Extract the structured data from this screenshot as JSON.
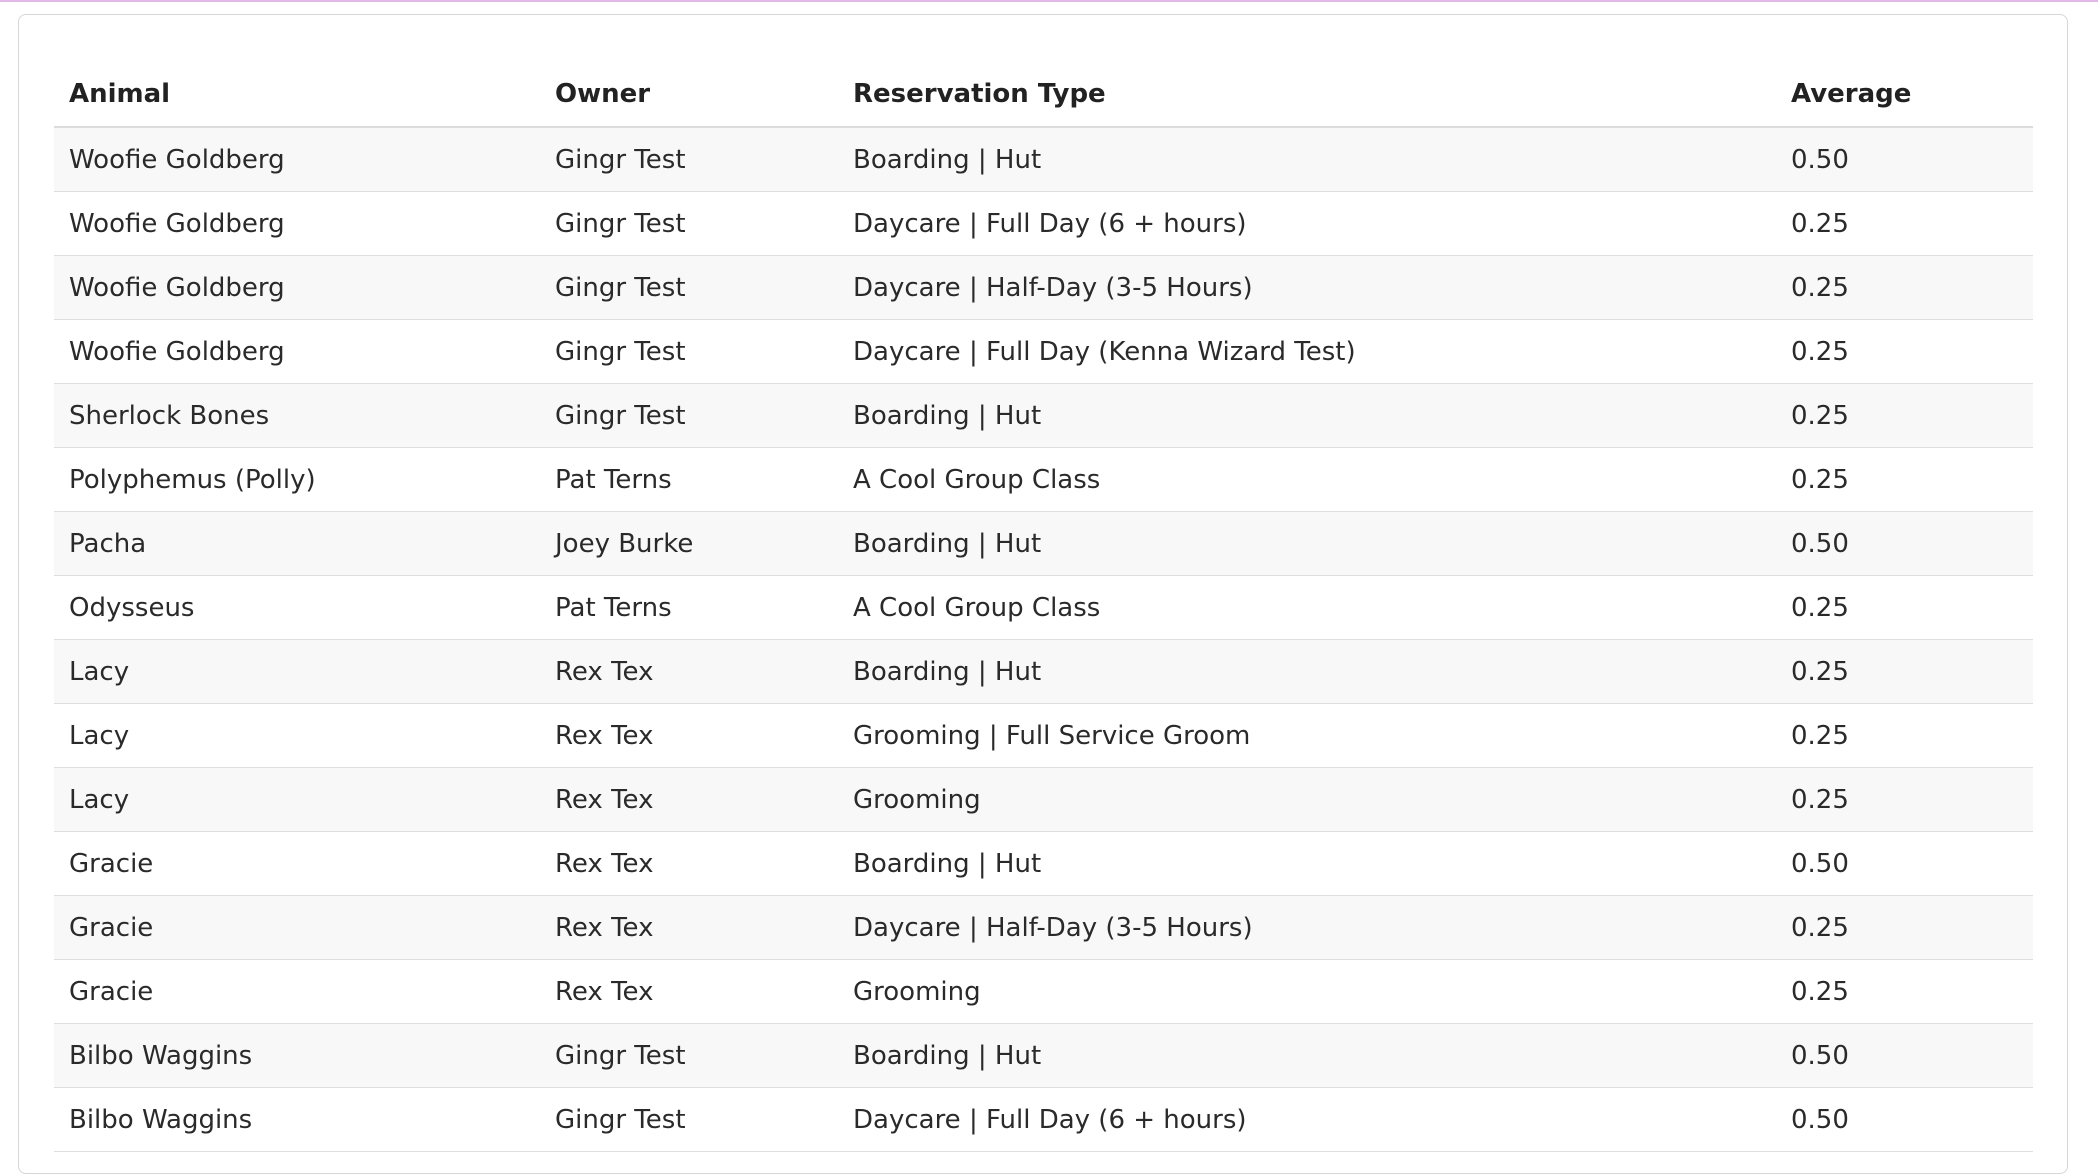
{
  "table": {
    "columns": [
      "Animal",
      "Owner",
      "Reservation Type",
      "Average"
    ],
    "rows": [
      {
        "animal": "Woofie Goldberg",
        "owner": "Gingr Test",
        "type": "Boarding | Hut",
        "average": "0.50"
      },
      {
        "animal": "Woofie Goldberg",
        "owner": "Gingr Test",
        "type": "Daycare | Full Day (6 + hours)",
        "average": "0.25"
      },
      {
        "animal": "Woofie Goldberg",
        "owner": "Gingr Test",
        "type": "Daycare | Half-Day (3-5 Hours)",
        "average": "0.25"
      },
      {
        "animal": "Woofie Goldberg",
        "owner": "Gingr Test",
        "type": "Daycare | Full Day (Kenna Wizard Test)",
        "average": "0.25"
      },
      {
        "animal": "Sherlock Bones",
        "owner": "Gingr Test",
        "type": "Boarding | Hut",
        "average": "0.25"
      },
      {
        "animal": "Polyphemus (Polly)",
        "owner": "Pat Terns",
        "type": "A Cool Group Class",
        "average": "0.25"
      },
      {
        "animal": "Pacha",
        "owner": "Joey Burke",
        "type": "Boarding | Hut",
        "average": "0.50"
      },
      {
        "animal": "Odysseus",
        "owner": "Pat Terns",
        "type": "A Cool Group Class",
        "average": "0.25"
      },
      {
        "animal": "Lacy",
        "owner": "Rex Tex",
        "type": "Boarding | Hut",
        "average": "0.25"
      },
      {
        "animal": "Lacy",
        "owner": "Rex Tex",
        "type": "Grooming | Full Service Groom",
        "average": "0.25"
      },
      {
        "animal": "Lacy",
        "owner": "Rex Tex",
        "type": "Grooming",
        "average": "0.25"
      },
      {
        "animal": "Gracie",
        "owner": "Rex Tex",
        "type": "Boarding | Hut",
        "average": "0.50"
      },
      {
        "animal": "Gracie",
        "owner": "Rex Tex",
        "type": "Daycare | Half-Day (3-5 Hours)",
        "average": "0.25"
      },
      {
        "animal": "Gracie",
        "owner": "Rex Tex",
        "type": "Grooming",
        "average": "0.25"
      },
      {
        "animal": "Bilbo Waggins",
        "owner": "Gingr Test",
        "type": "Boarding | Hut",
        "average": "0.50"
      },
      {
        "animal": "Bilbo Waggins",
        "owner": "Gingr Test",
        "type": "Daycare | Full Day (6 + hours)",
        "average": "0.50"
      }
    ]
  },
  "colors": {
    "accent": "#e2b8e8",
    "row_stripe": "#f8f8f8",
    "border": "#dedede"
  }
}
